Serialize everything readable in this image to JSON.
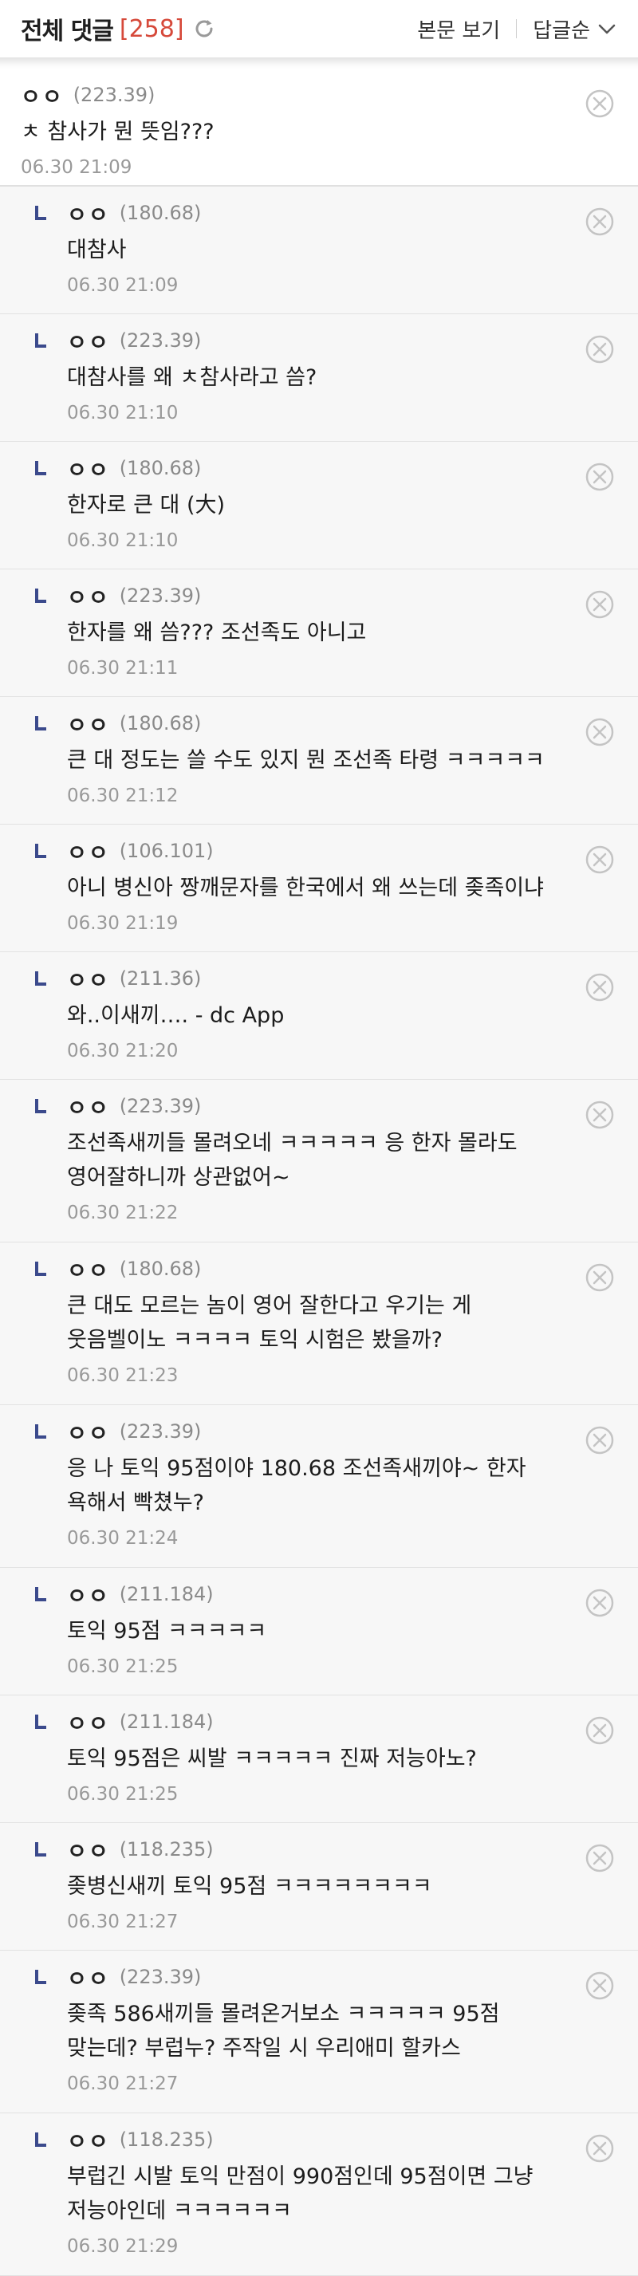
{
  "header": {
    "title": "전체 댓글",
    "count": "[258]",
    "view_post": "본문 보기",
    "sort": "답글순"
  },
  "comments": [
    {
      "nick": "ㅇㅇ",
      "ip": "(223.39)",
      "text": "ㅊ 참사가 뭔 뜻임???",
      "date": "06.30 21:09",
      "reply": false
    },
    {
      "nick": "ㅇㅇ",
      "ip": "(180.68)",
      "text": "대참사",
      "date": "06.30 21:09",
      "reply": true
    },
    {
      "nick": "ㅇㅇ",
      "ip": "(223.39)",
      "text": "대참사를 왜 ㅊ참사라고 씀?",
      "date": "06.30 21:10",
      "reply": true
    },
    {
      "nick": "ㅇㅇ",
      "ip": "(180.68)",
      "text": "한자로 큰 대 (大)",
      "date": "06.30 21:10",
      "reply": true
    },
    {
      "nick": "ㅇㅇ",
      "ip": "(223.39)",
      "text": "한자를 왜 씀??? 조선족도 아니고",
      "date": "06.30 21:11",
      "reply": true
    },
    {
      "nick": "ㅇㅇ",
      "ip": "(180.68)",
      "text": "큰 대 정도는 쓸 수도 있지 뭔 조선족 타령 ㅋㅋㅋㅋㅋ",
      "date": "06.30 21:12",
      "reply": true
    },
    {
      "nick": "ㅇㅇ",
      "ip": "(106.101)",
      "text": "아니 병신아 짱깨문자를 한국에서 왜 쓰는데 좆족이냐",
      "date": "06.30 21:19",
      "reply": true
    },
    {
      "nick": "ㅇㅇ",
      "ip": "(211.36)",
      "text": "와..이새끼…. - dc App",
      "date": "06.30 21:20",
      "reply": true
    },
    {
      "nick": "ㅇㅇ",
      "ip": "(223.39)",
      "text": "조선족새끼들 몰려오네 ㅋㅋㅋㅋㅋ 응 한자 몰라도 영어잘하니까 상관없어~",
      "date": "06.30 21:22",
      "reply": true
    },
    {
      "nick": "ㅇㅇ",
      "ip": "(180.68)",
      "text": "큰 대도 모르는 놈이 영어 잘한다고 우기는 게 웃음벨이노 ㅋㅋㅋㅋ 토익 시험은 봤을까?",
      "date": "06.30 21:23",
      "reply": true
    },
    {
      "nick": "ㅇㅇ",
      "ip": "(223.39)",
      "text": "응 나 토익 95점이야 180.68 조선족새끼야~ 한자 욕해서 빡쳤누?",
      "date": "06.30 21:24",
      "reply": true
    },
    {
      "nick": "ㅇㅇ",
      "ip": "(211.184)",
      "text": "토익 95점 ㅋㅋㅋㅋㅋ",
      "date": "06.30 21:25",
      "reply": true
    },
    {
      "nick": "ㅇㅇ",
      "ip": "(211.184)",
      "text": "토익 95점은 씨발 ㅋㅋㅋㅋㅋ 진짜 저능아노?",
      "date": "06.30 21:25",
      "reply": true
    },
    {
      "nick": "ㅇㅇ",
      "ip": "(118.235)",
      "text": "좆병신새끼 토익 95점 ㅋㅋㅋㅋㅋㅋㅋㅋ",
      "date": "06.30 21:27",
      "reply": true
    },
    {
      "nick": "ㅇㅇ",
      "ip": "(223.39)",
      "text": "좆족 586새끼들 몰려온거보소 ㅋㅋㅋㅋㅋ 95점 맞는데? 부럽누? 주작일 시 우리애미 할카스",
      "date": "06.30 21:27",
      "reply": true
    },
    {
      "nick": "ㅇㅇ",
      "ip": "(118.235)",
      "text": "부럽긴 시발 토익 만점이 990점인데 95점이면 그냥 저능아인데 ㅋㅋㅋㅋㅋㅋ",
      "date": "06.30 21:29",
      "reply": true
    }
  ],
  "colors": {
    "accent": "#d6493a",
    "reply_icon": "#3b4a8c",
    "delete_icon": "#c4c4c4"
  },
  "icons": {
    "refresh": "refresh-icon",
    "sort": "chevron-down-icon",
    "delete": "close-circle-icon",
    "reply": "reply-arrow-icon"
  }
}
